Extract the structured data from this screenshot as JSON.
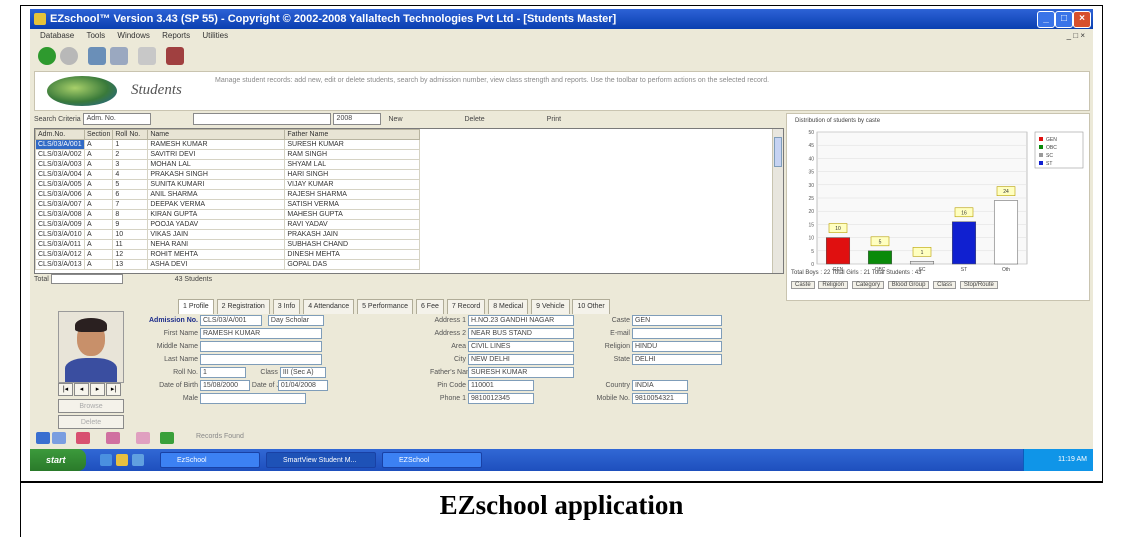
{
  "window": {
    "title": "EZschool™ Version 3.43 (SP 55) - Copyright © 2002-2008 Yallaltech Technologies Pvt Ltd - [Students Master]",
    "menu": [
      "Database",
      "Tools",
      "Windows",
      "Reports",
      "Utilities"
    ]
  },
  "banner": {
    "title": "Students",
    "description": "Manage student records: add new, edit or delete students, search by admission number, view class strength and reports. Use the toolbar to perform actions on the selected record."
  },
  "search": {
    "label": "Search Criteria",
    "criteria": "Adm. No.",
    "class": "2008",
    "new_label": "New",
    "delete_label": "Delete",
    "print_label": "Print"
  },
  "grid": {
    "columns": [
      "Adm.No.",
      "Section",
      "Roll No.",
      "Name",
      "Father Name"
    ],
    "rows": [
      [
        "CLS/03/A/001",
        "A",
        "1",
        "RAMESH KUMAR",
        "SURESH KUMAR"
      ],
      [
        "CLS/03/A/002",
        "A",
        "2",
        "SAVITRI DEVI",
        "RAM SINGH"
      ],
      [
        "CLS/03/A/003",
        "A",
        "3",
        "MOHAN LAL",
        "SHYAM LAL"
      ],
      [
        "CLS/03/A/004",
        "A",
        "4",
        "PRAKASH SINGH",
        "HARI SINGH"
      ],
      [
        "CLS/03/A/005",
        "A",
        "5",
        "SUNITA KUMARI",
        "VIJAY KUMAR"
      ],
      [
        "CLS/03/A/006",
        "A",
        "6",
        "ANIL SHARMA",
        "RAJESH SHARMA"
      ],
      [
        "CLS/03/A/007",
        "A",
        "7",
        "DEEPAK VERMA",
        "SATISH VERMA"
      ],
      [
        "CLS/03/A/008",
        "A",
        "8",
        "KIRAN GUPTA",
        "MAHESH GUPTA"
      ],
      [
        "CLS/03/A/009",
        "A",
        "9",
        "POOJA YADAV",
        "RAVI YADAV"
      ],
      [
        "CLS/03/A/010",
        "A",
        "10",
        "VIKAS JAIN",
        "PRAKASH JAIN"
      ],
      [
        "CLS/03/A/011",
        "A",
        "11",
        "NEHA RANI",
        "SUBHASH CHAND"
      ],
      [
        "CLS/03/A/012",
        "A",
        "12",
        "ROHIT MEHTA",
        "DINESH MEHTA"
      ],
      [
        "CLS/03/A/013",
        "A",
        "13",
        "ASHA DEVI",
        "GOPAL DAS"
      ]
    ],
    "total_label": "Total",
    "count_label": "43 Students"
  },
  "chart_data": {
    "type": "bar",
    "title": "Distribution of students by caste",
    "categories": [
      "GEN",
      "OBC",
      "SC",
      "ST",
      "Oth"
    ],
    "values": [
      10,
      5,
      1,
      16,
      24
    ],
    "ylim": [
      0,
      50
    ],
    "colors": [
      "#e01010",
      "#0a8a0a",
      "#e8e8e8",
      "#1020d0",
      "#ffffff"
    ],
    "legend": [
      "GEN",
      "OBC",
      "SC",
      "ST"
    ],
    "footer": "Total Boys : 22  Total Girls : 21  Total Students : 43",
    "tabs": [
      "Caste",
      "Religion",
      "Category",
      "Blood Group",
      "Class",
      "Stop/Route"
    ]
  },
  "tabs": [
    "1 Profile",
    "2 Registration",
    "3 Info",
    "4 Attendance",
    "5 Performance",
    "6 Fee",
    "7 Record",
    "8 Medical",
    "9 Vehicle",
    "10 Other"
  ],
  "form": {
    "admission_no_label": "Admission No.",
    "admission_no": "CLS/03/A/001",
    "category_value": "Day Scholar",
    "first_name_label": "First Name",
    "first_name": "RAMESH KUMAR",
    "middle_name_label": "Middle Name",
    "middle_name": "",
    "last_name_label": "Last Name",
    "last_name": "",
    "roll_no_label": "Roll No.",
    "roll_no": "1",
    "class_label": "Class",
    "class_value": "III (Sec A)",
    "date_of_birth_label": "Date of Birth",
    "date_of_birth": "15/08/2000",
    "date_of_join_label": "Date of Join",
    "date_of_join": "01/04/2008",
    "gender_label": "Male",
    "address_label": "Address 1",
    "address1": "H.NO.23 GANDHI NAGAR",
    "address2_label": "Address 2",
    "address2": "NEAR BUS STAND",
    "area_label": "Area",
    "area": "CIVIL LINES",
    "city_label": "City",
    "city": "NEW DELHI",
    "pincode_label": "Pin Code",
    "pincode": "110001",
    "phone_label": "Phone 1",
    "phone": "9810012345",
    "email_label": "E-mail",
    "email": "",
    "caste_label": "Caste",
    "caste": "GEN",
    "religion_label": "Religion",
    "religion": "HINDU",
    "state_label": "State",
    "state": "DELHI",
    "country_label": "Country",
    "country": "INDIA",
    "mobile_label": "Mobile No.",
    "mobile": "9810054321",
    "details_label": "Father's Name",
    "details": "SURESH KUMAR"
  },
  "photo": {
    "browse_label": "Browse",
    "delete_label": "Delete"
  },
  "navbar": {
    "status": "Records Found"
  },
  "taskbar": {
    "start": "start",
    "tasks": [
      "EzSchool",
      "SmartView Student M...",
      "EZSchool"
    ],
    "clock": "11:19 AM"
  },
  "caption": "EZschool application"
}
